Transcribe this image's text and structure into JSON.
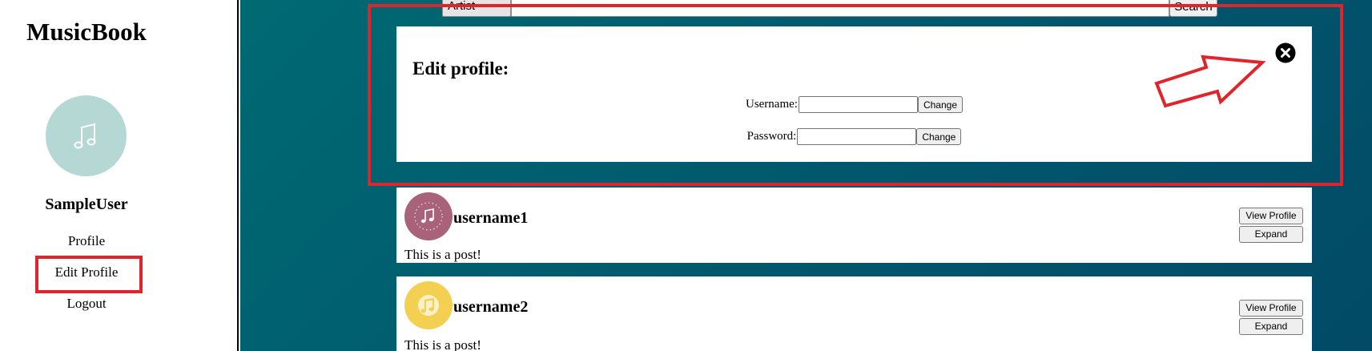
{
  "sidebar": {
    "brand": "MusicBook",
    "avatar_icon": "music-note-icon",
    "username": "SampleUser",
    "nav": [
      {
        "label": "Profile"
      },
      {
        "label": "Edit Profile"
      },
      {
        "label": "Logout"
      }
    ]
  },
  "search": {
    "filter_value": "Artist",
    "input_value": "",
    "button_label": "Search"
  },
  "edit_modal": {
    "title": "Edit profile:",
    "username_label": "Username:",
    "username_value": "",
    "password_label": "Password:",
    "password_value": "",
    "change_label": "Change",
    "close_icon": "close-circle-icon"
  },
  "posts": [
    {
      "username": "username1",
      "text": "This is a post!",
      "avatar_color": "#a8627a",
      "view_label": "View Profile",
      "expand_label": "Expand"
    },
    {
      "username": "username2",
      "text": "This is a post!",
      "avatar_color": "#f3cf52",
      "view_label": "View Profile",
      "expand_label": "Expand"
    }
  ],
  "colors": {
    "annotation": "#e0242b",
    "avatar": "#b5d8d5",
    "background_start": "#006a72",
    "background_end": "#024a66"
  }
}
